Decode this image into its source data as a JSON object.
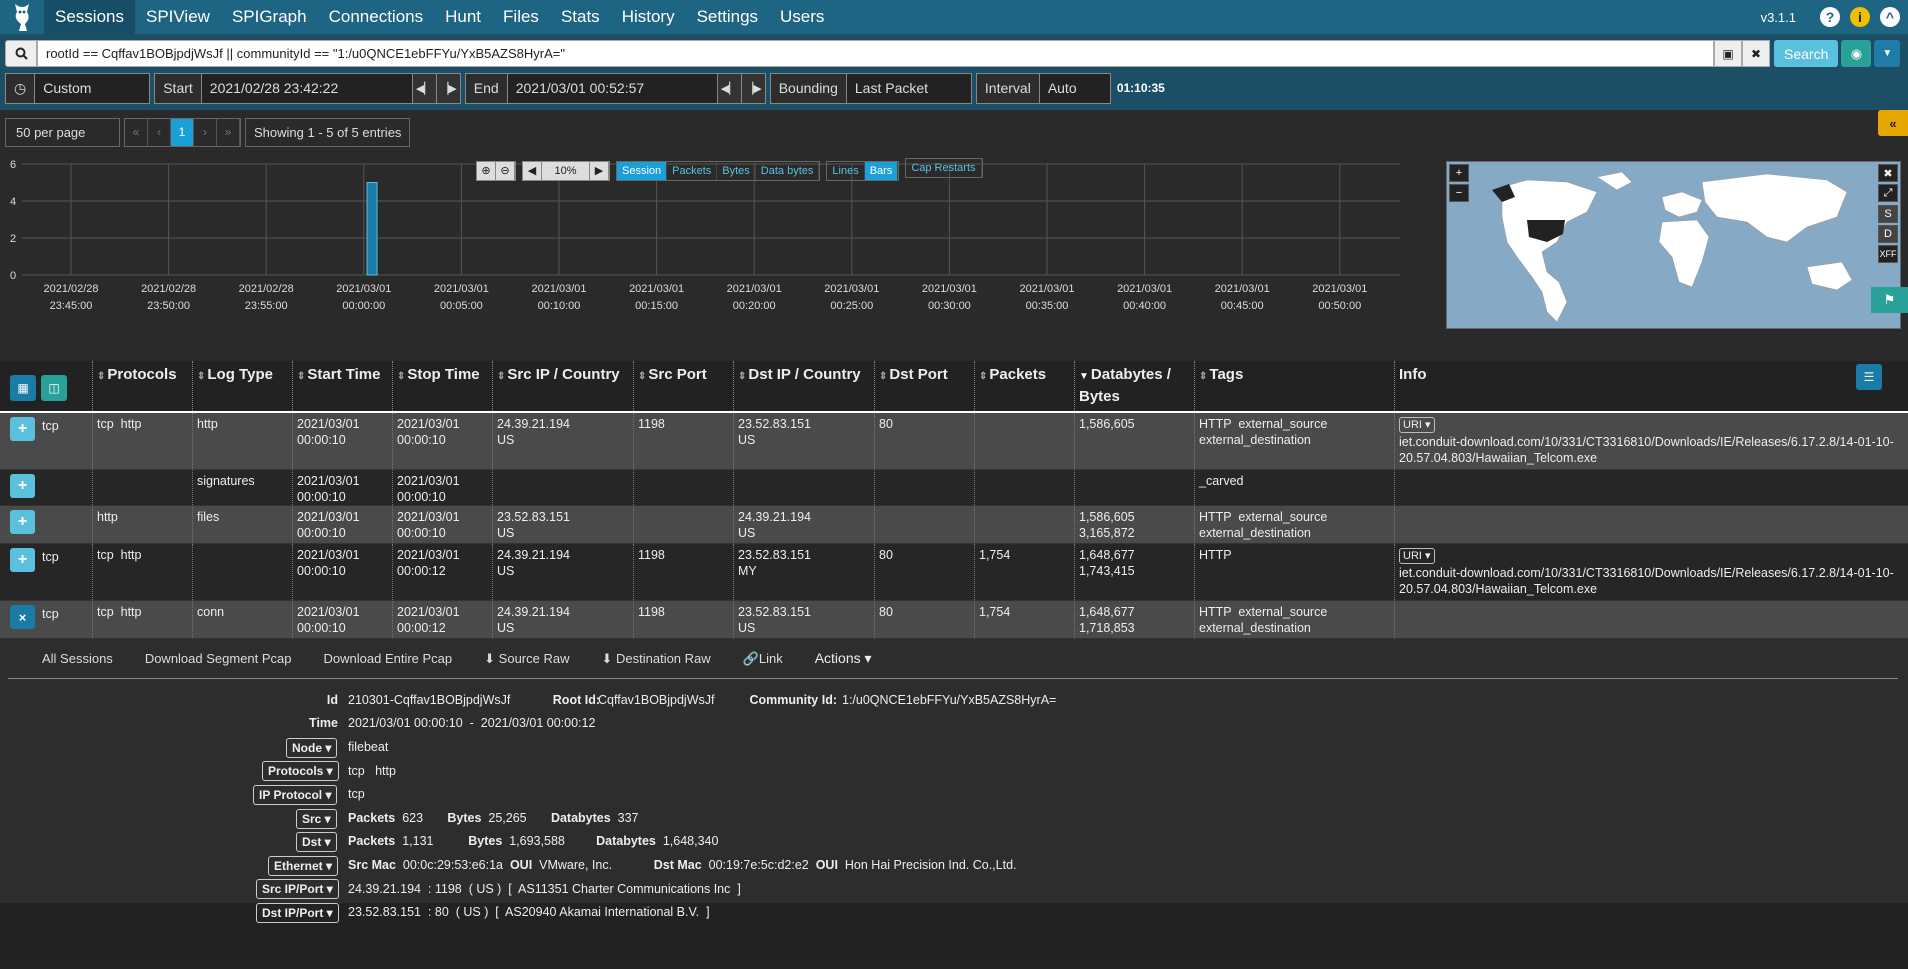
{
  "nav": {
    "items": [
      "Sessions",
      "SPIView",
      "SPIGraph",
      "Connections",
      "Hunt",
      "Files",
      "Stats",
      "History",
      "Settings",
      "Users"
    ],
    "version": "v3.1.1"
  },
  "search": {
    "query": "rootId == Cqffav1BOBjpdjWsJf || communityId == \"1:/u0QNCE1ebFFYu/YxB5AZS8HyrA=\"",
    "button": "Search"
  },
  "time": {
    "range": "Custom",
    "start_label": "Start",
    "start": "2021/02/28 23:42:22",
    "end_label": "End",
    "end": "2021/03/01 00:52:57",
    "bounding_label": "Bounding",
    "bounding": "Last Packet",
    "interval_label": "Interval",
    "interval": "Auto",
    "duration": "01:10:35"
  },
  "pager": {
    "per_page": "50 per page",
    "first": "«",
    "prev": "‹",
    "page": "1",
    "next": "›",
    "last": "»",
    "info": "Showing 1 - 5 of 5 entries"
  },
  "graph": {
    "zoom": "10%",
    "type_buttons": [
      "Session",
      "Packets",
      "Bytes",
      "Data bytes"
    ],
    "style_buttons": [
      "Lines",
      "Bars"
    ],
    "cap_restarts": "Cap Restarts"
  },
  "chart_data": {
    "type": "bar",
    "ylim": [
      0,
      6
    ],
    "yticks": [
      "0",
      "2",
      "4",
      "6"
    ],
    "xticks": [
      [
        "2021/02/28",
        "23:45:00"
      ],
      [
        "2021/02/28",
        "23:50:00"
      ],
      [
        "2021/02/28",
        "23:55:00"
      ],
      [
        "2021/03/01",
        "00:00:00"
      ],
      [
        "2021/03/01",
        "00:05:00"
      ],
      [
        "2021/03/01",
        "00:10:00"
      ],
      [
        "2021/03/01",
        "00:15:00"
      ],
      [
        "2021/03/01",
        "00:20:00"
      ],
      [
        "2021/03/01",
        "00:25:00"
      ],
      [
        "2021/03/01",
        "00:30:00"
      ],
      [
        "2021/03/01",
        "00:35:00"
      ],
      [
        "2021/03/01",
        "00:40:00"
      ],
      [
        "2021/03/01",
        "00:45:00"
      ],
      [
        "2021/03/01",
        "00:50:00"
      ]
    ],
    "bars": [
      {
        "x": "2021/03/01 00:00:10",
        "value": 5
      }
    ]
  },
  "map_buttons": [
    "S",
    "D",
    "XFF"
  ],
  "columns": [
    "Protocols",
    "Log Type",
    "Start Time",
    "Stop Time",
    "Src IP / Country",
    "Src Port",
    "Dst IP / Country",
    "Dst Port",
    "Packets",
    "Databytes / Bytes",
    "Tags",
    "Info"
  ],
  "rows": [
    {
      "btn": "+",
      "proto1": "tcp",
      "protocols": "tcp  http",
      "logtype": "http",
      "start": "2021/03/01 00:00:10",
      "stop": "2021/03/01 00:00:10",
      "src": "24.39.21.194",
      "srcc": "US",
      "sport": "1198",
      "dst": "23.52.83.151",
      "dstc": "US",
      "dport": "80",
      "packets": "",
      "db1": "1,586,605",
      "db2": "",
      "tags": "HTTP  external_source external_destination",
      "uri": "URI ▾",
      "info": "iet.conduit-download.com/10/331/CT3316810/Downloads/IE/Releases/6.17.2.8/14-01-10-20.57.04.803/Hawaiian_Telcom.exe"
    },
    {
      "btn": "+",
      "proto1": "",
      "protocols": "",
      "logtype": "signatures",
      "start": "2021/03/01 00:00:10",
      "stop": "2021/03/01 00:00:10",
      "src": "",
      "srcc": "",
      "sport": "",
      "dst": "",
      "dstc": "",
      "dport": "",
      "packets": "",
      "db1": "",
      "db2": "",
      "tags": "_carved",
      "uri": "",
      "info": ""
    },
    {
      "btn": "+",
      "proto1": "",
      "protocols": "http",
      "logtype": "files",
      "start": "2021/03/01 00:00:10",
      "stop": "2021/03/01 00:00:10",
      "src": "23.52.83.151",
      "srcc": "US",
      "sport": "",
      "dst": "24.39.21.194",
      "dstc": "US",
      "dport": "",
      "packets": "",
      "db1": "1,586,605",
      "db2": "3,165,872",
      "tags": "HTTP  external_source external_destination",
      "uri": "",
      "info": ""
    },
    {
      "btn": "+",
      "proto1": "tcp",
      "protocols": "tcp  http",
      "logtype": "",
      "start": "2021/03/01 00:00:10",
      "stop": "2021/03/01 00:00:12",
      "src": "24.39.21.194",
      "srcc": "US",
      "sport": "1198",
      "dst": "23.52.83.151",
      "dstc": "MY",
      "dport": "80",
      "packets": "1,754",
      "db1": "1,648,677",
      "db2": "1,743,415",
      "tags": "HTTP",
      "uri": "URI ▾",
      "info": "iet.conduit-download.com/10/331/CT3316810/Downloads/IE/Releases/6.17.2.8/14-01-10-20.57.04.803/Hawaiian_Telcom.exe"
    },
    {
      "btn": "×",
      "proto1": "tcp",
      "protocols": "tcp  http",
      "logtype": "conn",
      "start": "2021/03/01 00:00:10",
      "stop": "2021/03/01 00:00:12",
      "src": "24.39.21.194",
      "srcc": "US",
      "sport": "1198",
      "dst": "23.52.83.151",
      "dstc": "US",
      "dport": "80",
      "packets": "1,754",
      "db1": "1,648,677",
      "db2": "1,718,853",
      "tags": "HTTP  external_source external_destination",
      "uri": "",
      "info": ""
    }
  ],
  "detail": {
    "actions": [
      "All Sessions",
      "Download Segment Pcap",
      "Download Entire Pcap",
      "Source Raw",
      "Destination Raw",
      "Link",
      "Actions ▾"
    ],
    "id_label": "Id",
    "id": "210301-Cqffav1BOBjpdjWsJf",
    "rootid_label": "Root Id:",
    "rootid": "Cqffav1BOBjpdjWsJf",
    "community_label": "Community Id:",
    "community": "1:/u0QNCE1ebFFYu/YxB5AZS8HyrA=",
    "time_label": "Time",
    "time": "2021/03/01 00:00:10  -  2021/03/01 00:00:12",
    "node_label": "Node ▾",
    "node": "filebeat",
    "protocols_label": "Protocols ▾",
    "protocols": "tcp   http",
    "ipproto_label": "IP Protocol ▾",
    "ipproto": "tcp",
    "src_label": "Src ▾",
    "src_packets": "623",
    "src_bytes": "25,265",
    "src_databytes": "337",
    "dst_label": "Dst ▾",
    "dst_packets": "1,131",
    "dst_bytes": "1,693,588",
    "dst_databytes": "1,648,340",
    "packets_word": "Packets",
    "bytes_word": "Bytes",
    "databytes_word": "Databytes",
    "eth_label": "Ethernet ▾",
    "srcmac_label": "Src Mac",
    "srcmac": "00:0c:29:53:e6:1a",
    "oui_label": "OUI",
    "srcoui": "VMware, Inc.",
    "dstmac_label": "Dst Mac",
    "dstmac": "00:19:7e:5c:d2:e2",
    "dstoui": "Hon Hai Precision Ind. Co.,Ltd.",
    "srcipport_label": "Src IP/Port ▾",
    "srcipport": "24.39.21.194  : 1198  ( US )  [  AS11351 Charter Communications Inc  ]",
    "dstipport_label": "Dst IP/Port ▾",
    "dstipport": "23.52.83.151  : 80  ( US )  [  AS20940 Akamai International B.V.  ]"
  }
}
